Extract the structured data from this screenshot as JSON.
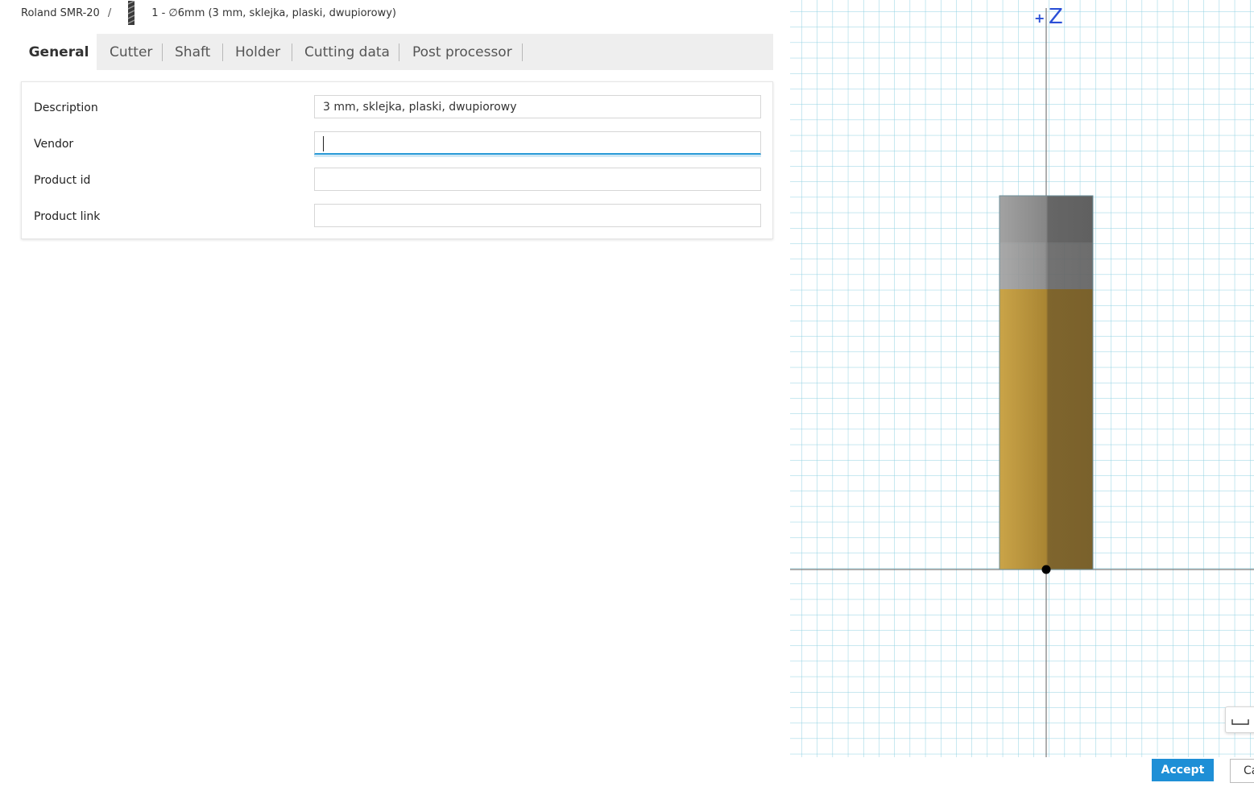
{
  "breadcrumb": {
    "machine": "Roland SMR-20",
    "separator": "/",
    "tool_icon": "end-mill-icon",
    "tool": "1 - ∅6mm (3 mm, sklejka, plaski, dwupiorowy)"
  },
  "tabs": [
    {
      "label": "General",
      "active": true
    },
    {
      "label": "Cutter",
      "active": false
    },
    {
      "label": "Shaft",
      "active": false
    },
    {
      "label": "Holder",
      "active": false
    },
    {
      "label": "Cutting data",
      "active": false
    },
    {
      "label": "Post processor",
      "active": false
    }
  ],
  "form": {
    "description": {
      "label": "Description",
      "value": "3 mm, sklejka, plaski, dwupiorowy"
    },
    "vendor": {
      "label": "Vendor",
      "value": ""
    },
    "product_id": {
      "label": "Product id",
      "value": ""
    },
    "product_link": {
      "label": "Product link",
      "value": ""
    }
  },
  "viewport": {
    "axis_label": "Z",
    "axis_sign": "+",
    "colors": {
      "grid": "#7ec8dc",
      "axis": "#7a7a7a",
      "holder": "#7a7a7a",
      "cutter": "#b8913a",
      "origin": "#000000"
    }
  },
  "footer": {
    "accept_label": "Accept",
    "cancel_label": "Ca"
  }
}
